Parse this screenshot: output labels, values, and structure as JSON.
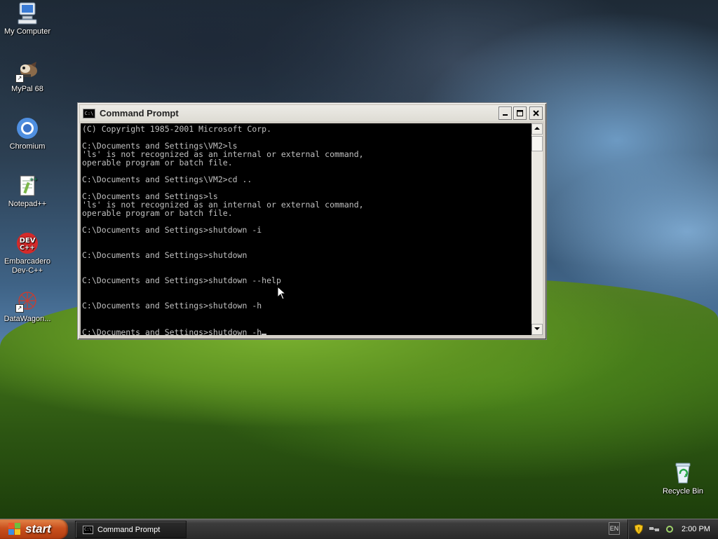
{
  "desktop": {
    "icons": [
      {
        "label": "My Computer",
        "icon": "my-computer-icon"
      },
      {
        "label": "MyPal 68",
        "icon": "mypal-icon"
      },
      {
        "label": "Chromium",
        "icon": "chromium-icon"
      },
      {
        "label": "Notepad++",
        "icon": "notepad-plus-plus-icon"
      },
      {
        "label": "Embarcadero\nDev-C++",
        "icon": "dev-cpp-icon"
      },
      {
        "label": "DataWagon...",
        "icon": "datawagon-icon"
      },
      {
        "label": "Recycle Bin",
        "icon": "recycle-bin-icon"
      }
    ]
  },
  "window": {
    "title": "Command Prompt",
    "icon_text": "C:\\",
    "console_lines": [
      "(C) Copyright 1985-2001 Microsoft Corp.",
      "",
      "C:\\Documents and Settings\\VM2>ls",
      "'ls' is not recognized as an internal or external command,",
      "operable program or batch file.",
      "",
      "C:\\Documents and Settings\\VM2>cd ..",
      "",
      "C:\\Documents and Settings>ls",
      "'ls' is not recognized as an internal or external command,",
      "operable program or batch file.",
      "",
      "C:\\Documents and Settings>shutdown -i",
      "",
      "",
      "C:\\Documents and Settings>shutdown",
      "",
      "",
      "C:\\Documents and Settings>shutdown --help",
      "",
      "",
      "C:\\Documents and Settings>shutdown -h",
      "",
      ""
    ],
    "current_prompt": "C:\\Documents and Settings>shutdown -h"
  },
  "taskbar": {
    "start_label": "start",
    "tasks": [
      {
        "label": "Command Prompt",
        "icon_text": "C:\\"
      }
    ],
    "language": "EN",
    "clock": "2:00 PM"
  }
}
